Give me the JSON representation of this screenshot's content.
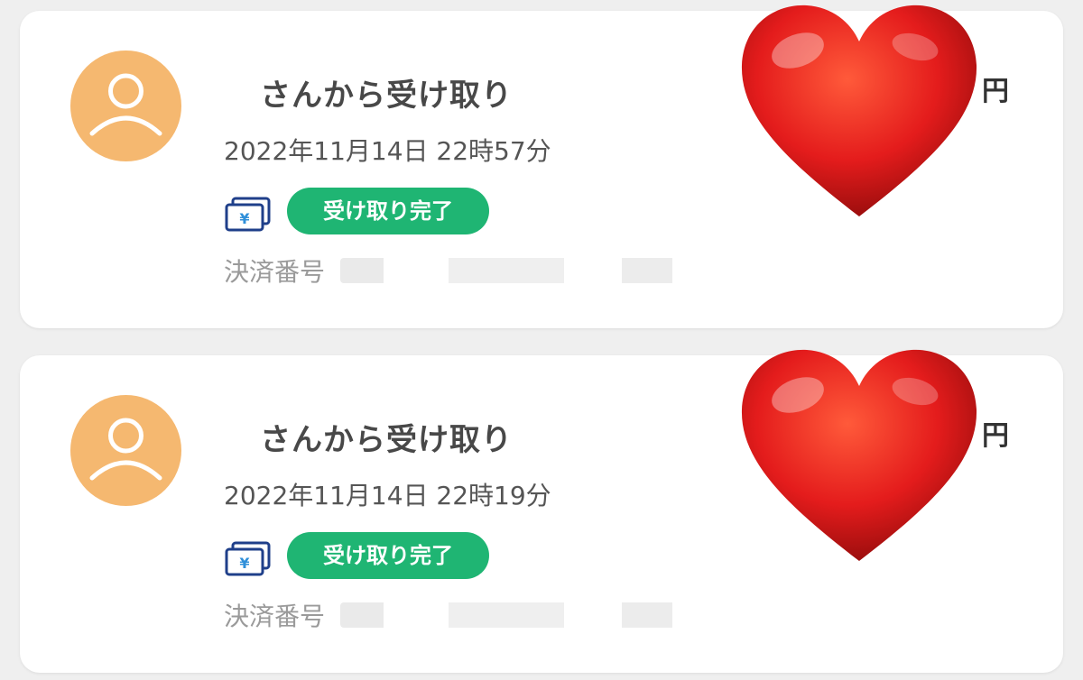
{
  "transactions": [
    {
      "title": "さんから受け取り",
      "datetime": "2022年11月14日 22時57分",
      "status": "受け取り完了",
      "payment_label": "決済番号",
      "amount_suffix": "円"
    },
    {
      "title": "さんから受け取り",
      "datetime": "2022年11月14日 22時19分",
      "status": "受け取り完了",
      "payment_label": "決済番号",
      "amount_suffix": "円"
    }
  ],
  "icons": {
    "avatar": "person-icon",
    "money": "yen-banknote-icon",
    "overlay": "heart-icon"
  },
  "colors": {
    "background": "#efefef",
    "card": "#ffffff",
    "avatar": "#f5b870",
    "status_badge": "#1fb573",
    "money_icon": "#1f3f8a",
    "heart": "#e41c1c"
  }
}
